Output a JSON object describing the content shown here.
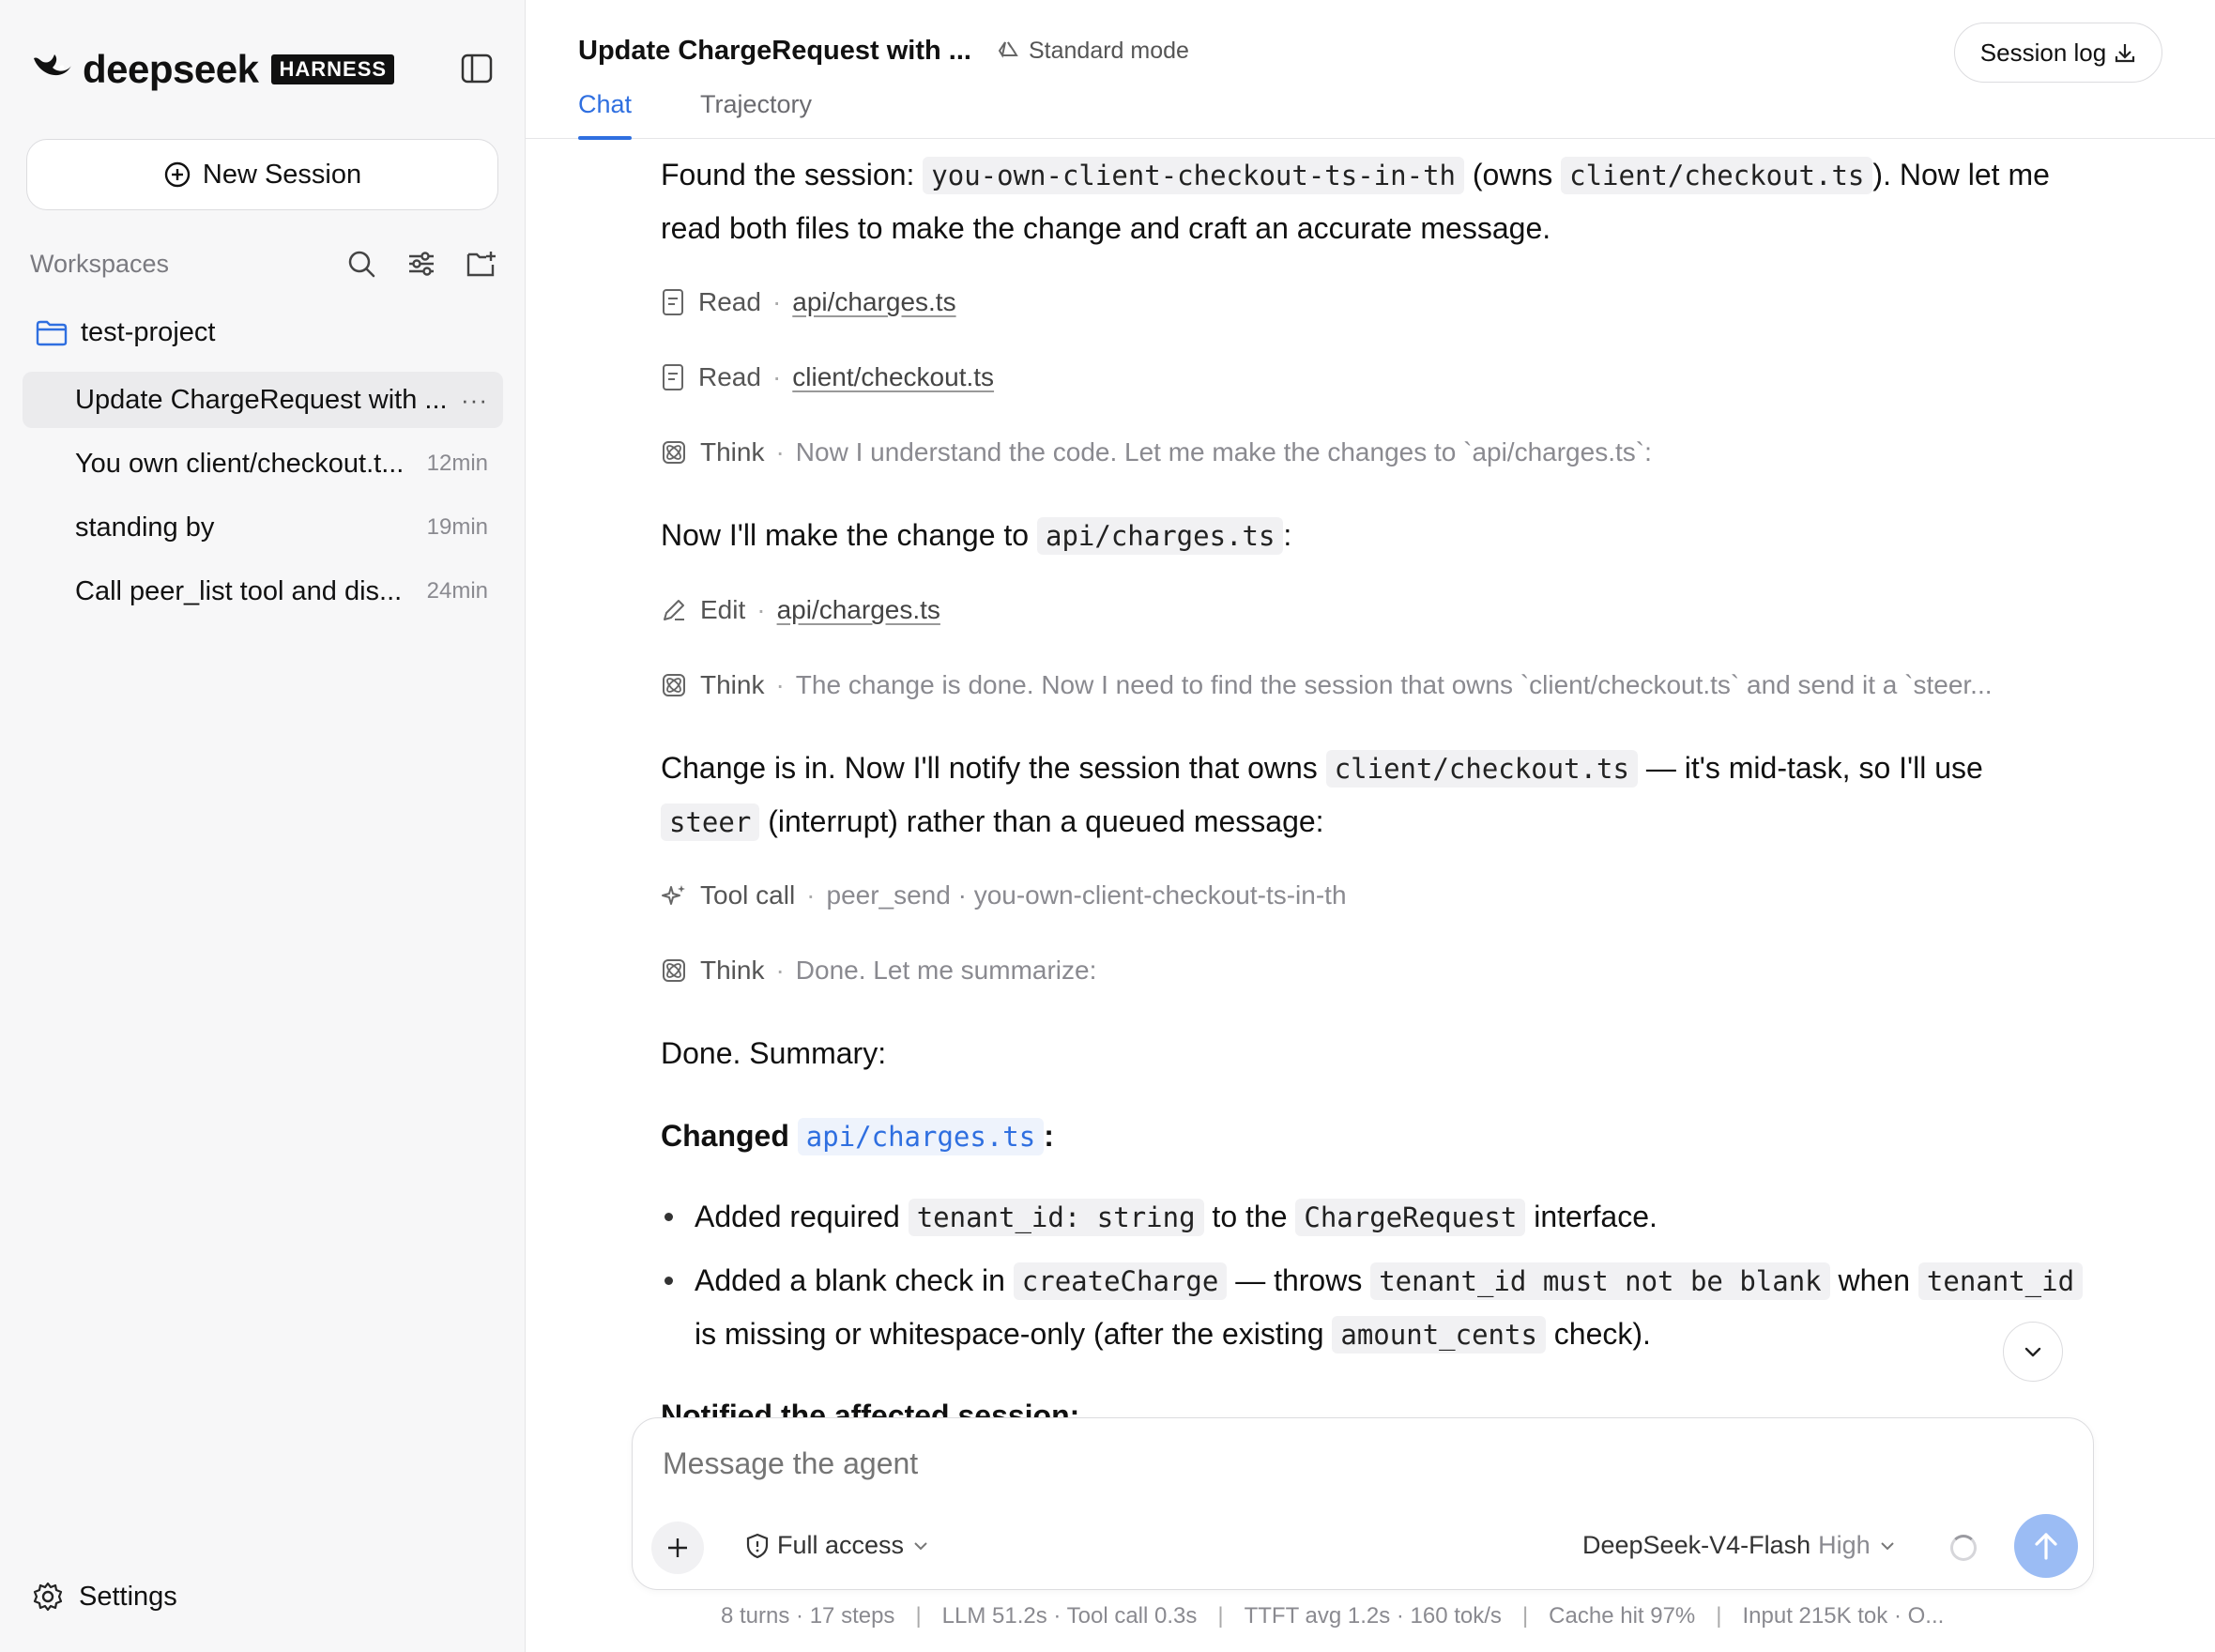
{
  "sidebar": {
    "brand": "deepseek",
    "badge": "HARNESS",
    "new_session_label": "New Session",
    "workspaces_label": "Workspaces",
    "project_name": "test-project",
    "sessions": [
      {
        "title": "Update ChargeRequest with ...",
        "age": "",
        "active": true
      },
      {
        "title": "You own client/checkout.t...",
        "age": "12min"
      },
      {
        "title": "standing by",
        "age": "19min"
      },
      {
        "title": "Call peer_list tool and dis...",
        "age": "24min"
      }
    ],
    "more_label": "···",
    "settings_label": "Settings"
  },
  "header": {
    "title": "Update ChargeRequest with ...",
    "mode": "Standard mode",
    "session_log": "Session log",
    "tabs": [
      "Chat",
      "Trajectory"
    ]
  },
  "chat": {
    "p1": {
      "a": "Found the session: ",
      "code1": "you-own-client-checkout-ts-in-th",
      "b": " (owns ",
      "code2": "client/checkout.ts",
      "c": "). Now let me",
      "d": "read both files to make the change and craft an accurate message."
    },
    "steps": [
      {
        "type": "Read",
        "sep": "·",
        "text": "api/charges.ts"
      },
      {
        "type": "Read",
        "sep": "·",
        "text": "client/checkout.ts"
      },
      {
        "type": "Think",
        "sep": "·",
        "text": "Now I understand the code. Let me make the changes to `api/charges.ts`:"
      },
      {
        "type": "Edit",
        "sep": "·",
        "text": "api/charges.ts"
      },
      {
        "type": "Think",
        "sep": "·",
        "text": "The change is done. Now I need to find the session that owns `client/checkout.ts` and send it a `steer..."
      },
      {
        "type": "Tool call",
        "sep": "·",
        "text": "peer_send · you-own-client-checkout-ts-in-th"
      },
      {
        "type": "Think",
        "sep": "·",
        "text": "Done. Let me summarize:"
      }
    ],
    "p2": {
      "a": "Now I'll make the change to ",
      "code": "api/charges.ts",
      "b": ":"
    },
    "p3": {
      "a": "Change is in. Now I'll notify the session that owns ",
      "code1": "client/checkout.ts",
      "b": " — it's mid-task, so I'll use",
      "code2": "steer",
      "c": " (interrupt) rather than a queued message:"
    },
    "p4": "Done. Summary:",
    "changed": {
      "label": "Changed",
      "code": "api/charges.ts",
      "colon": ":"
    },
    "bullet1": {
      "a": "Added required ",
      "code1": "tenant_id: string",
      "b": " to the ",
      "code2": "ChargeRequest",
      "c": " interface."
    },
    "bullet2": {
      "a": "Added a blank check in ",
      "code1": "createCharge",
      "b": " — throws ",
      "code2": "tenant_id must not be blank",
      "c": " when ",
      "code3": "tenant_id",
      "d": "is missing or whitespace-only (after the existing ",
      "code4": "amount_cents",
      "e": " check)."
    },
    "cutoff": "Notified the affected session:"
  },
  "composer": {
    "placeholder": "Message the agent",
    "access": "Full access",
    "model": "DeepSeek-V4-Flash",
    "level": "High"
  },
  "stats": {
    "items": [
      "8 turns · 17 steps",
      "LLM 51.2s · Tool call 0.3s",
      "TTFT avg 1.2s · 160 tok/s",
      "Cache hit 97%",
      "Input 215K tok · O..."
    ],
    "sep": "|"
  },
  "colors": {
    "accent": "#2f6fe0",
    "send_button": "#9bbcf4",
    "sidebar_bg": "#f7f7f8"
  }
}
